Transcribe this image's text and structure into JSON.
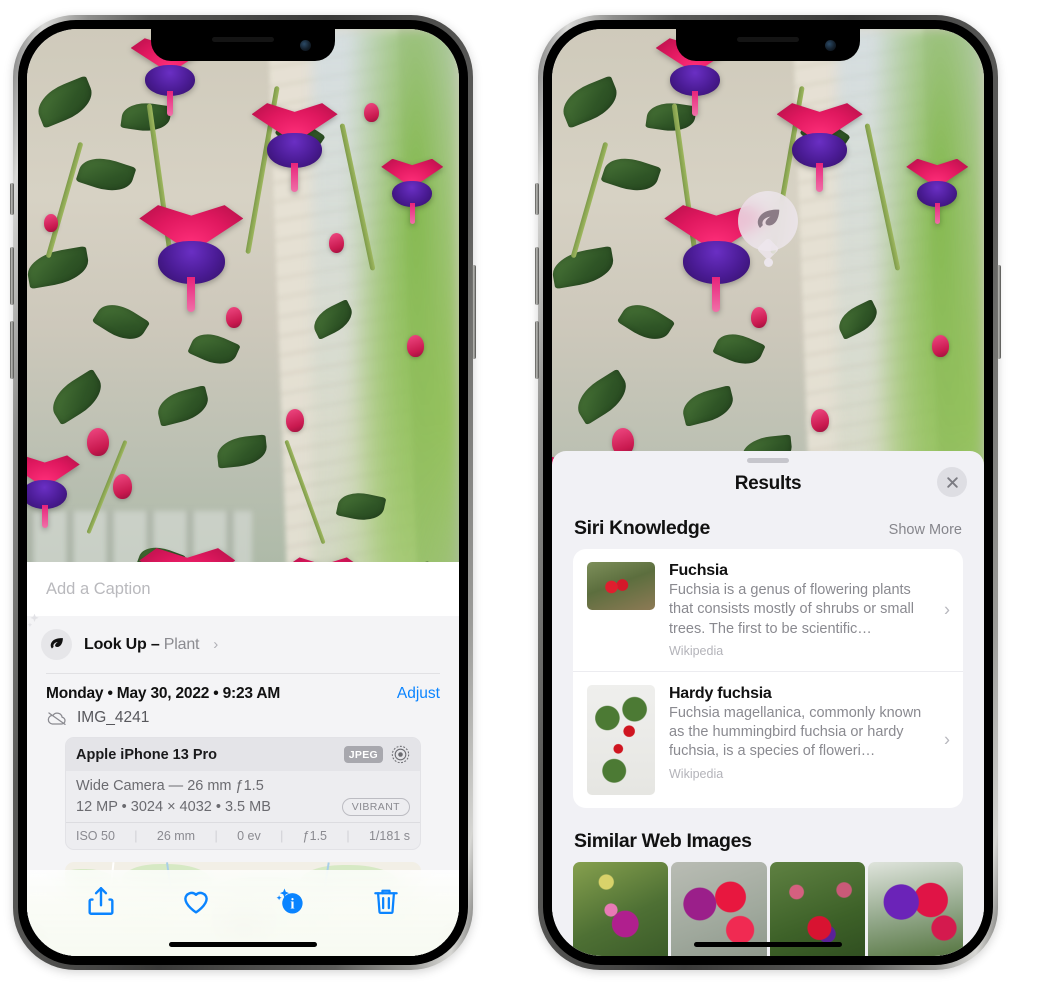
{
  "left_phone": {
    "caption": {
      "placeholder": "Add a Caption",
      "value": ""
    },
    "lookup": {
      "label": "Look Up",
      "dash": "–",
      "kind": "Plant",
      "chevron": "›",
      "icon": "leaf-icon"
    },
    "meta": {
      "date_line": "Monday • May 30, 2022 • 9:23 AM",
      "adjust_label": "Adjust",
      "filename": "IMG_4241",
      "cloud_icon": "cloud-slash-icon"
    },
    "exif": {
      "device": "Apple iPhone 13 Pro",
      "format_tag": "JPEG",
      "aperture_icon": "aperture-icon",
      "lens_line": "Wide Camera — 26 mm ƒ1.5",
      "spec_line": "12 MP • 3024 × 4032 • 3.5 MB",
      "style_pill": "VIBRANT",
      "footer": [
        "ISO 50",
        "26 mm",
        "0 ev",
        "ƒ1.5",
        "1/181 s"
      ]
    },
    "toolbar": [
      {
        "name": "share-button",
        "icon": "share-icon"
      },
      {
        "name": "favorite-button",
        "icon": "heart-icon"
      },
      {
        "name": "info-button",
        "icon": "info-sparkle-icon"
      },
      {
        "name": "delete-button",
        "icon": "trash-icon"
      }
    ],
    "accent_color": "#0A84FF"
  },
  "right_phone": {
    "pin": {
      "icon": "leaf-icon"
    },
    "sheet": {
      "title": "Results",
      "close_icon": "close-icon",
      "sections": [
        {
          "title": "Siri Knowledge",
          "action": "Show More",
          "items": [
            {
              "title": "Fuchsia",
              "description": "Fuchsia is a genus of flowering plants that consists mostly of shrubs or small trees. The first to be scientific…",
              "source": "Wikipedia",
              "chevron": "›"
            },
            {
              "title": "Hardy fuchsia",
              "description": "Fuchsia magellanica, commonly known as the hummingbird fuchsia or hardy fuchsia, is a species of floweri…",
              "source": "Wikipedia",
              "chevron": "›"
            }
          ]
        },
        {
          "title": "Similar Web Images",
          "images": [
            "web-image-1",
            "web-image-2",
            "web-image-3",
            "web-image-4"
          ]
        }
      ]
    }
  }
}
